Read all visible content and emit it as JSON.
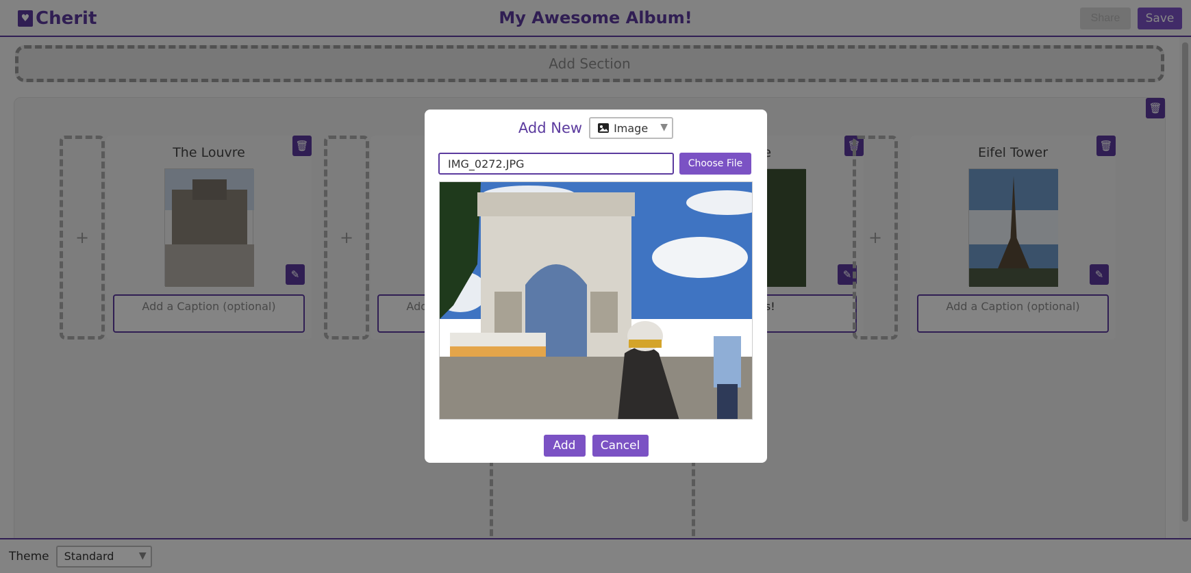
{
  "header": {
    "app_name": "Cherit",
    "album_title": "My Awesome Album!",
    "share_label": "Share",
    "save_label": "Save"
  },
  "add_section_label": "Add Section",
  "section": {
    "cards": [
      {
        "title": "The Louvre",
        "caption_placeholder": "Add a Caption (optional)"
      },
      {
        "title": "",
        "caption_placeholder": "Add a Caption (optional)"
      },
      {
        "title": "me",
        "caption_text": "sses!"
      },
      {
        "title": "Eifel Tower",
        "caption_placeholder": "Add a Caption (optional)"
      }
    ],
    "slot_symbol": "+"
  },
  "theme": {
    "label": "Theme",
    "value": "Standard"
  },
  "modal": {
    "title": "Add New",
    "type_value": "Image",
    "file_name": "IMG_0272.JPG",
    "choose_file_label": "Choose File",
    "add_label": "Add",
    "cancel_label": "Cancel"
  },
  "colors": {
    "accent": "#5b3a9e",
    "button": "#7b52c4"
  },
  "icons": [
    "heart-logo-icon",
    "trash-icon",
    "edit-icon",
    "image-icon",
    "caret-down-icon"
  ]
}
